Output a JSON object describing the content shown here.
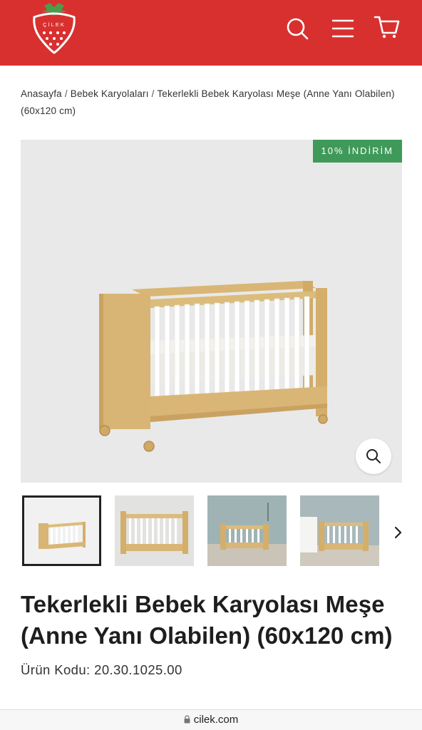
{
  "header": {
    "brand_letters": "ÇİLEK",
    "colors": {
      "brand_red": "#d8302f",
      "discount_green": "#3f9a5a"
    },
    "icons": [
      "search-icon",
      "menu-icon",
      "cart-icon"
    ]
  },
  "breadcrumb": {
    "items": [
      "Anasayfa",
      "Bebek Karyolaları",
      "Tekerlekli Bebek Karyolası Meşe (Anne Yanı Olabilen) (60x120 cm)"
    ],
    "separator": "/"
  },
  "gallery": {
    "badge": "10% İNDİRİM",
    "zoom_icon": "zoom-icon",
    "thumbnail_count_visible": 4,
    "active_thumbnail": 1,
    "next_icon": "chevron-right-icon"
  },
  "product": {
    "title": "Tekerlekli Bebek Karyolası Meşe (Anne Yanı Olabilen) (60x120 cm)",
    "sku_label": "Ürün Kodu:",
    "sku_value": "20.30.1025.00"
  },
  "browser": {
    "url": "cilek.com",
    "lock_icon": "lock-icon"
  }
}
